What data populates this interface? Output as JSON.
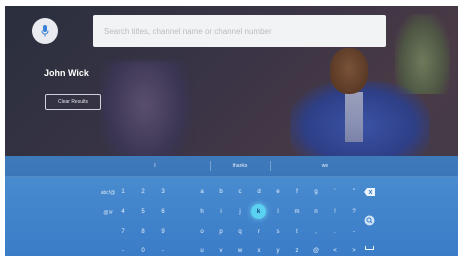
{
  "search": {
    "placeholder": "Search titles, channel name or channel number"
  },
  "result": {
    "title": "John Wick",
    "clear_button_label": "Clear Results"
  },
  "suggestions": [
    "I",
    "thanks",
    "we"
  ],
  "keyboard": {
    "mode_keys": [
      "abc!@",
      "@!#"
    ],
    "rows": [
      [
        "1",
        "2",
        "3",
        "a",
        "b",
        "c",
        "d",
        "e",
        "f",
        "g",
        "'",
        "\""
      ],
      [
        "4",
        "5",
        "6",
        "h",
        "i",
        "j",
        "k",
        "l",
        "m",
        "n",
        "!",
        "?"
      ],
      [
        "7",
        "8",
        "9",
        "o",
        "p",
        "q",
        "r",
        "s",
        "t",
        ",",
        ".",
        "-"
      ],
      [
        "-",
        "0",
        "-",
        "u",
        "v",
        "w",
        "x",
        "y",
        "z",
        "@",
        "<",
        ">"
      ]
    ],
    "selected_key": "k",
    "function_icons": [
      "backspace-icon",
      "search-icon",
      "space-icon"
    ]
  },
  "colors": {
    "keyboard_background": "#3f82cb",
    "selected_key": "#5ad1f0"
  }
}
